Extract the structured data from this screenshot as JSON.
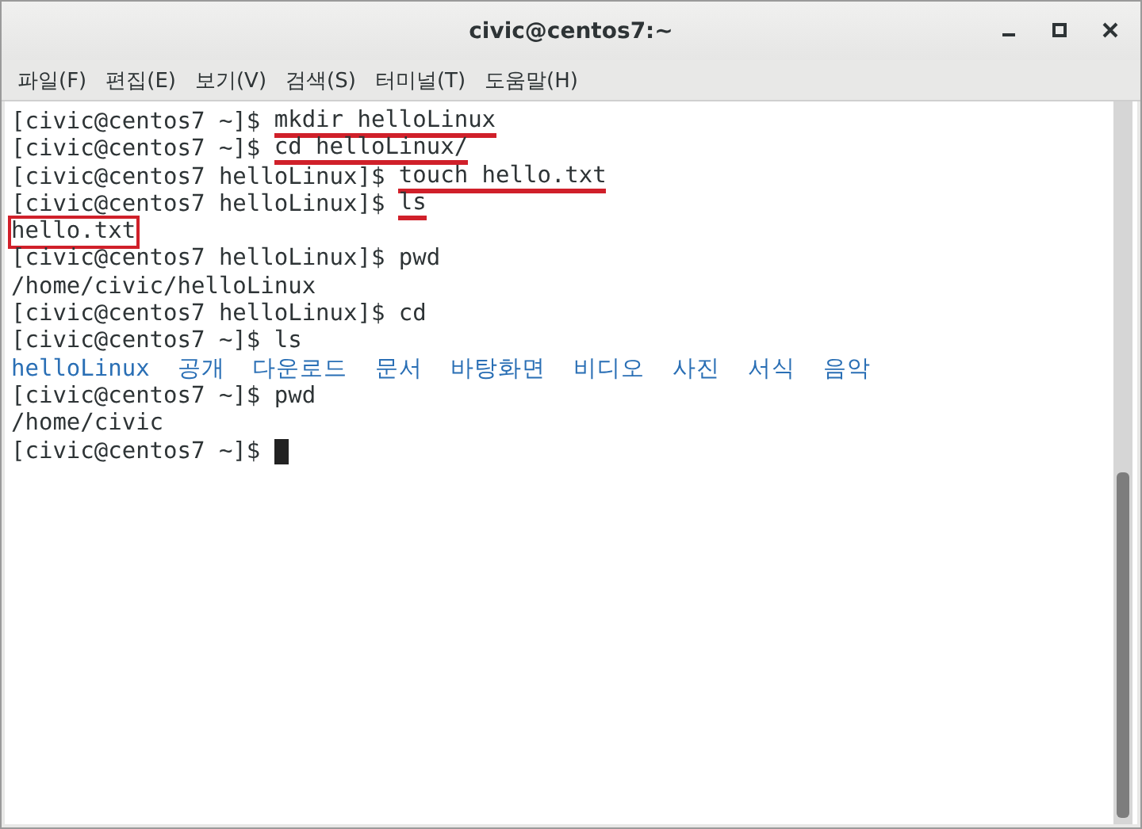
{
  "window": {
    "title": "civic@centos7:~"
  },
  "menu": [
    "파일(F)",
    "편집(E)",
    "보기(V)",
    "검색(S)",
    "터미널(T)",
    "도움말(H)"
  ],
  "terminal": {
    "lines": [
      {
        "kind": "prompt",
        "prompt": "[civic@centos7 ~]$",
        "command": "mkdir helloLinux",
        "underlined": true
      },
      {
        "kind": "prompt",
        "prompt": "[civic@centos7 ~]$",
        "command": "cd helloLinux/",
        "underlined": true
      },
      {
        "kind": "prompt",
        "prompt": "[civic@centos7 helloLinux]$",
        "command": "touch hello.txt",
        "underlined": true
      },
      {
        "kind": "prompt",
        "prompt": "[civic@centos7 helloLinux]$",
        "command": "ls",
        "underlined": true
      },
      {
        "kind": "output",
        "text": "hello.txt",
        "boxed": true
      },
      {
        "kind": "prompt",
        "prompt": "[civic@centos7 helloLinux]$",
        "command": "pwd",
        "underlined": false
      },
      {
        "kind": "output",
        "text": "/home/civic/helloLinux",
        "boxed": false
      },
      {
        "kind": "prompt",
        "prompt": "[civic@centos7 helloLinux]$",
        "command": "cd",
        "underlined": false
      },
      {
        "kind": "prompt",
        "prompt": "[civic@centos7 ~]$",
        "command": "ls",
        "underlined": false
      },
      {
        "kind": "listing",
        "items": [
          "helloLinux",
          "공개",
          "다운로드",
          "문서",
          "바탕화면",
          "비디오",
          "사진",
          "서식",
          "음악"
        ]
      },
      {
        "kind": "prompt",
        "prompt": "[civic@centos7 ~]$",
        "command": "pwd",
        "underlined": false
      },
      {
        "kind": "output",
        "text": "/home/civic",
        "boxed": false
      },
      {
        "kind": "cursor",
        "prompt": "[civic@centos7 ~]$"
      }
    ]
  }
}
